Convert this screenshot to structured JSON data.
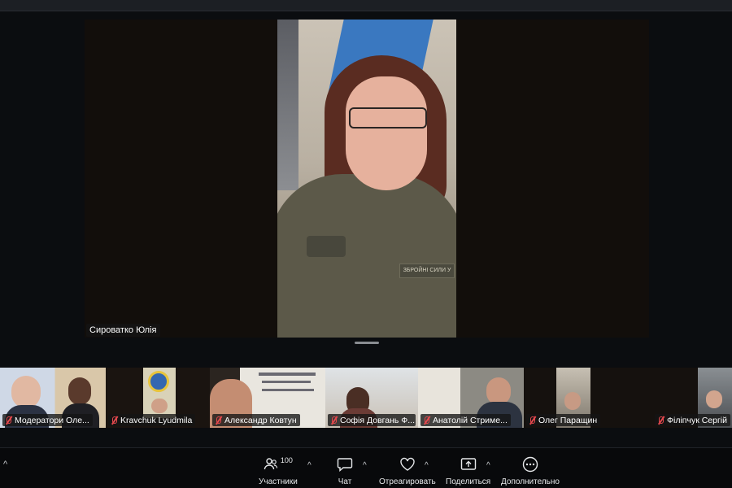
{
  "meeting": {
    "active_speaker": "Сироватко Юлія"
  },
  "participants": [
    {
      "name": "Модератори Оле..."
    },
    {
      "name": "Kravchuk Lyudmila"
    },
    {
      "name": "Александр Ковтун"
    },
    {
      "name": "Софія Довгань Ф..."
    },
    {
      "name": "Анатолій Стриме..."
    },
    {
      "name": "Олег Паращин"
    },
    {
      "name": "Філіпчук Сергій"
    }
  ],
  "toolbar": {
    "participants_label": "Участники",
    "participants_count": "100",
    "chat_label": "Чат",
    "react_label": "Отреагировать",
    "share_label": "Поделиться",
    "more_label": "Дополнительно",
    "caret": "^"
  },
  "video_overlay": {
    "patch_text": "ЗБРОЙНІ СИЛИ У"
  },
  "colors": {
    "background": "#0b0d10",
    "mic_muted": "#e5484d",
    "toolbar": "#08090b"
  }
}
